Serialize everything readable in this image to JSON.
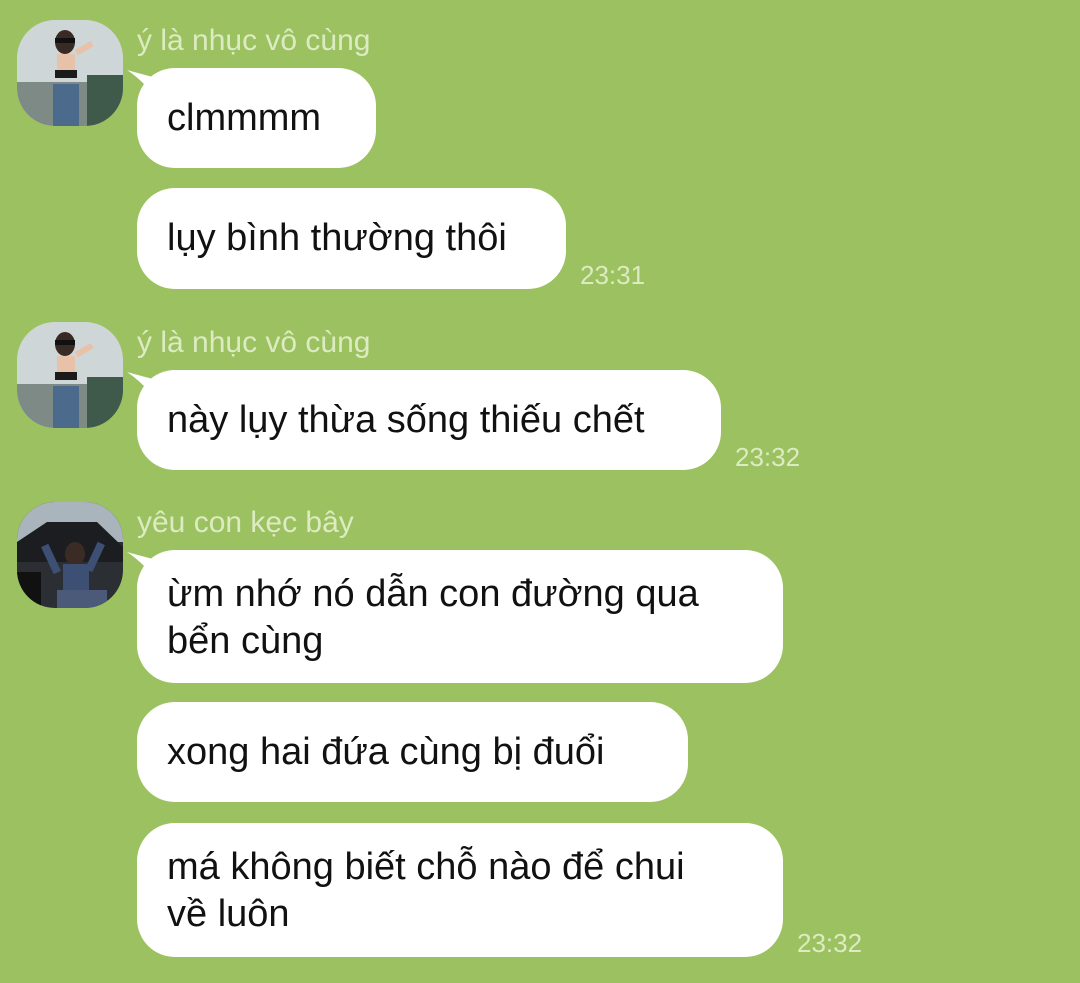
{
  "colors": {
    "background": "#9cc160",
    "bubble": "#ffffff",
    "meta_text": "#dcebc1",
    "message_text": "#111111"
  },
  "groups": [
    {
      "sender": "ý là nhục vô cùng",
      "avatar": "avatar-photo-woman",
      "messages": [
        "clmmmm",
        "lụy bình thường thôi"
      ],
      "time": "23:31"
    },
    {
      "sender": "ý là nhục vô cùng",
      "avatar": "avatar-photo-woman",
      "messages": [
        "này lụy thừa sống thiếu chết"
      ],
      "time": "23:32"
    },
    {
      "sender": "yêu con kẹc bây",
      "avatar": "avatar-photo-car",
      "messages": [
        "ừm nhớ nó dẫn con đường qua\nbển cùng",
        "xong hai đứa cùng bị đuổi",
        "má không biết chỗ nào để chui\nvề luôn"
      ],
      "time": "23:32"
    }
  ]
}
